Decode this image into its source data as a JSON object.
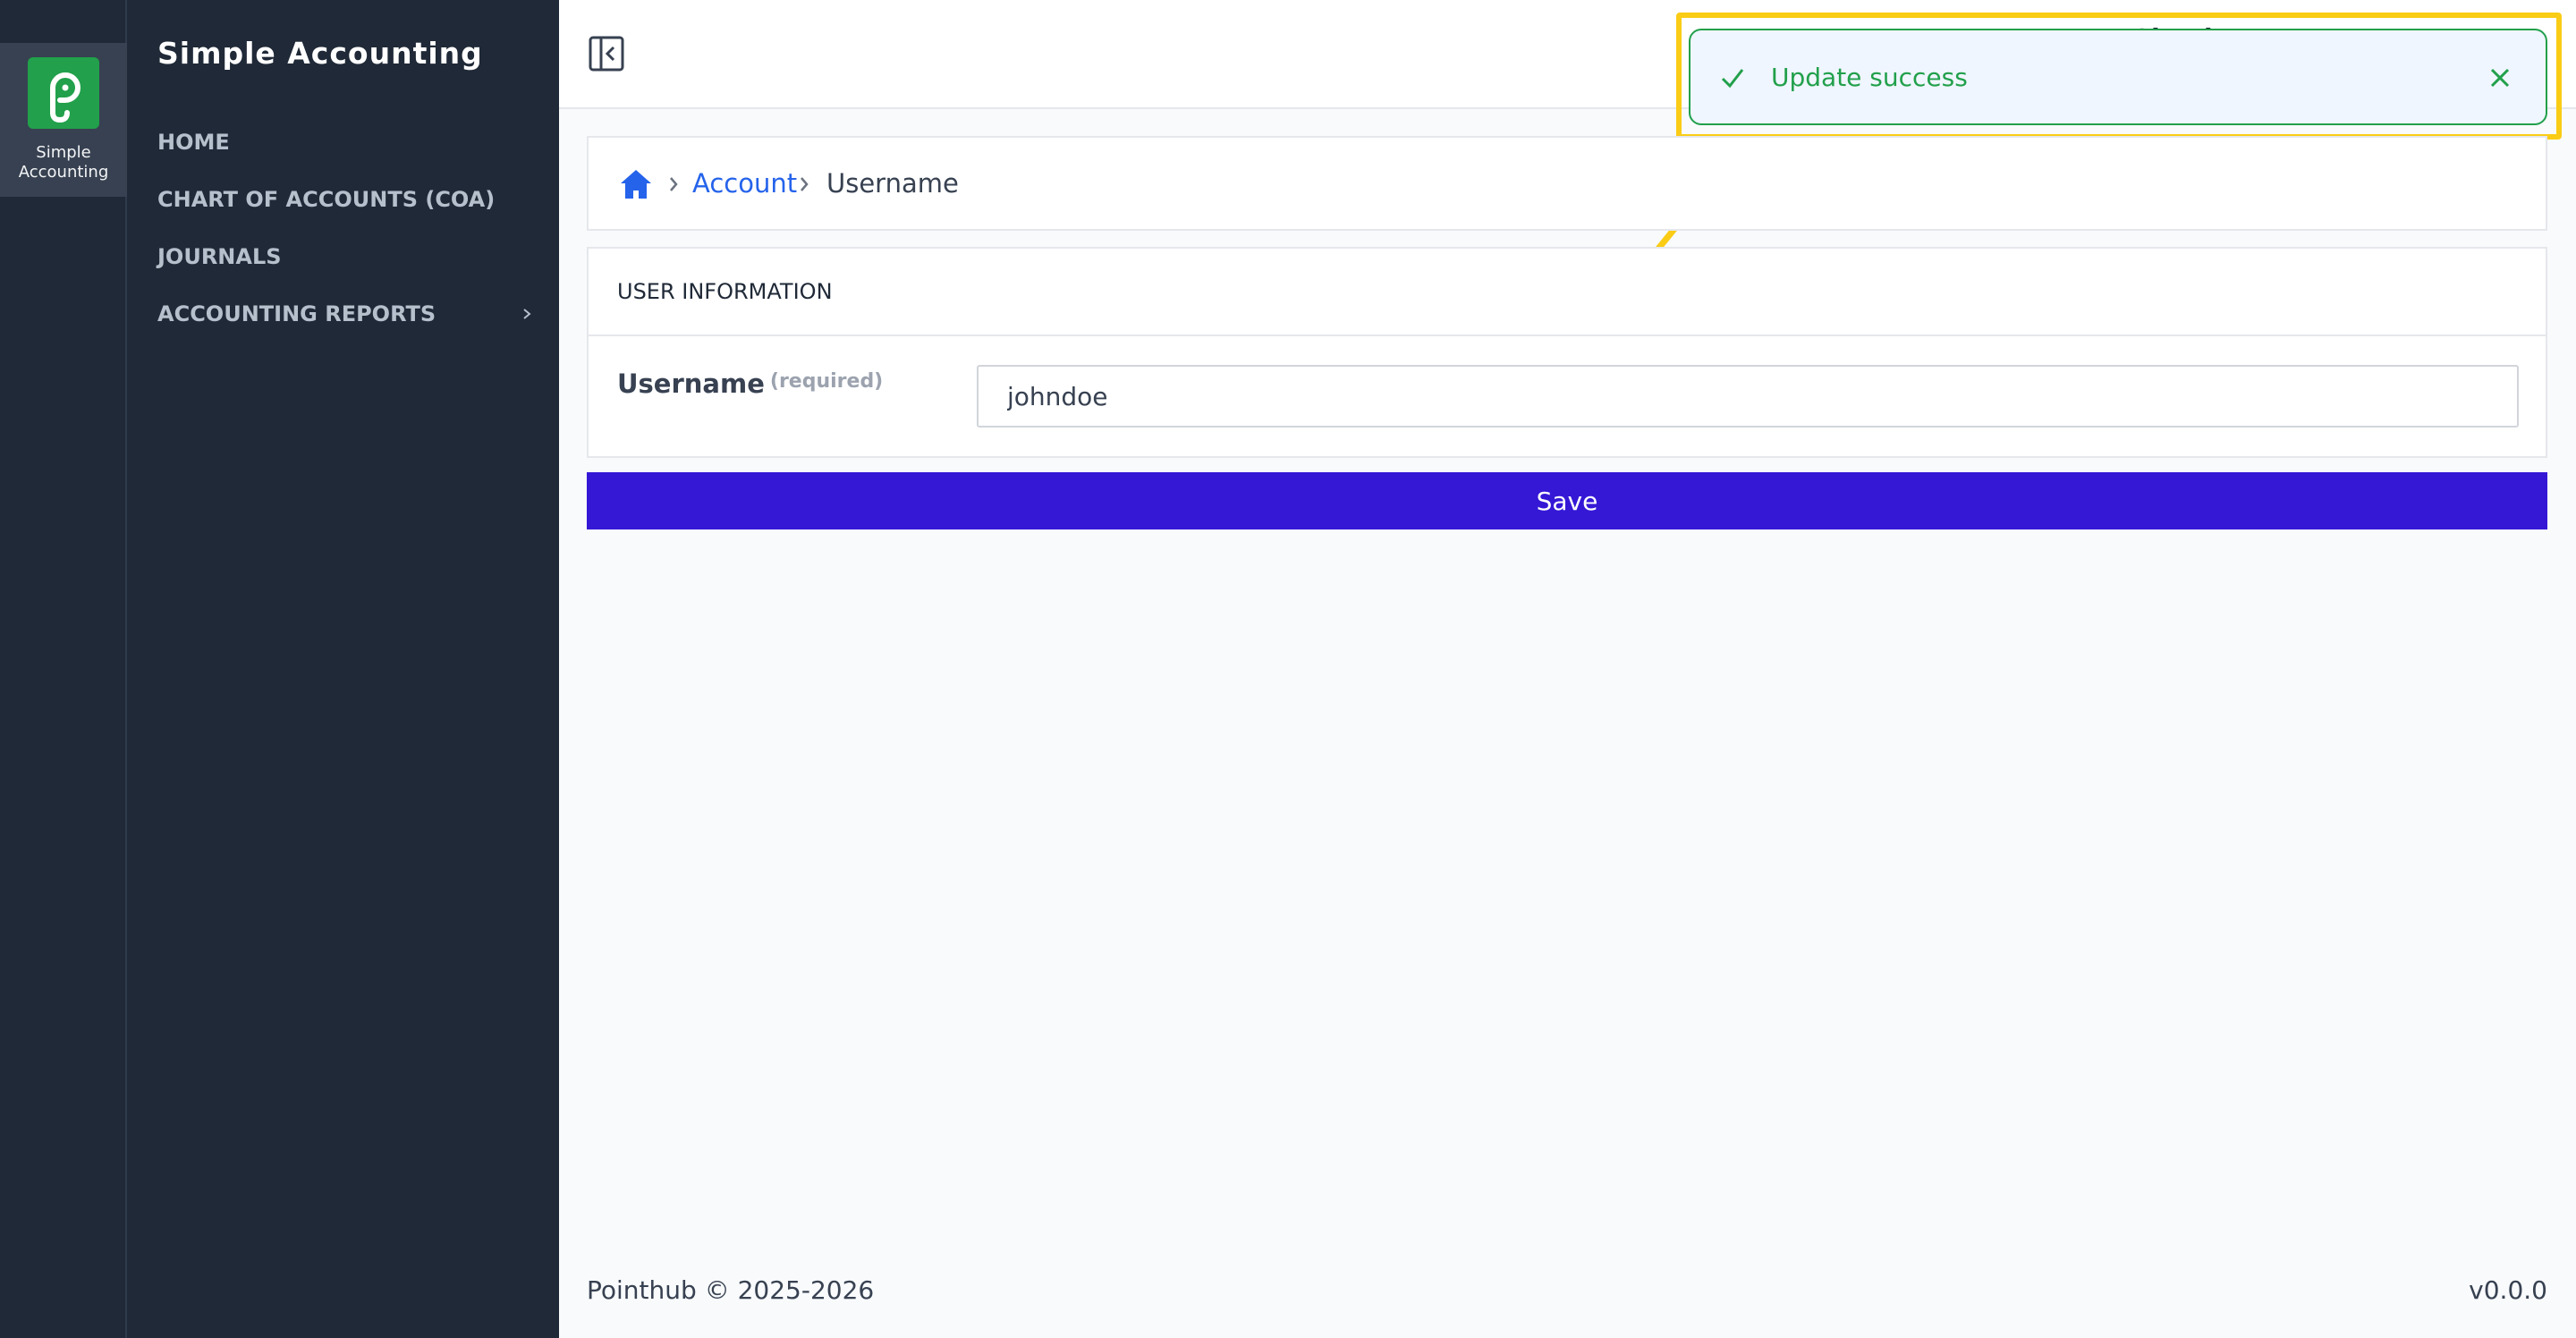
{
  "rail": {
    "app_label_line1": "Simple",
    "app_label_line2": "Accounting"
  },
  "sidebar": {
    "title": "Simple Accounting",
    "items": [
      {
        "label": "HOME"
      },
      {
        "label": "CHART OF ACCOUNTS (COA)"
      },
      {
        "label": "JOURNALS"
      },
      {
        "label": "ACCOUNTING REPORTS",
        "has_submenu": true
      }
    ]
  },
  "topbar": {
    "user_fragment": "Simple Accou"
  },
  "toast": {
    "message": "Update success",
    "status_color": "#22a04b"
  },
  "breadcrumb": {
    "items": [
      "Account",
      "Username"
    ]
  },
  "form": {
    "section_title": "USER INFORMATION",
    "username_label": "Username",
    "required_label": "(required)",
    "username_value": "johndoe",
    "save_label": "Save"
  },
  "footer": {
    "copyright": "Pointhub © 2025-2026",
    "version": "v0.0.0"
  },
  "colors": {
    "sidebar_bg": "#1f2937",
    "primary_button": "#3418d6",
    "link": "#2563eb",
    "annotation": "#facc15"
  }
}
